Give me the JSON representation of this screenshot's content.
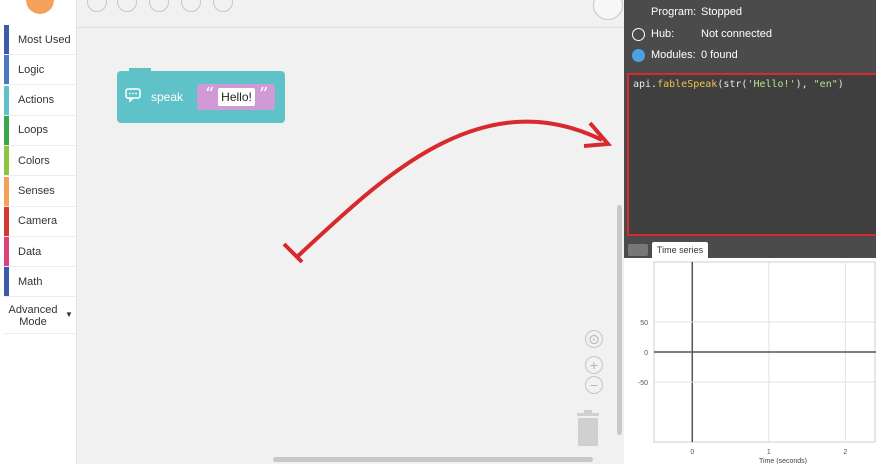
{
  "sidebar": {
    "categories": [
      {
        "label": "Most Used",
        "color": "#3d5aa8"
      },
      {
        "label": "Logic",
        "color": "#4a78c4"
      },
      {
        "label": "Actions",
        "color": "#5fc2c9"
      },
      {
        "label": "Loops",
        "color": "#3aa64a"
      },
      {
        "label": "Colors",
        "color": "#8cc63f"
      },
      {
        "label": "Senses",
        "color": "#f5a15a"
      },
      {
        "label": "Camera",
        "color": "#d23b34"
      },
      {
        "label": "Data",
        "color": "#e0417a"
      },
      {
        "label": "Math",
        "color": "#3d5aa8"
      }
    ],
    "advanced_mode": "Advanced Mode"
  },
  "workspace": {
    "block": {
      "label": "speak",
      "value": "Hello!",
      "color": "#5fc2c9",
      "slot_color": "#cf9ad5"
    },
    "icons": [
      "undo-icon",
      "redo-icon",
      "save-icon",
      "load-icon",
      "settings-icon",
      "search-icon",
      "center-icon",
      "zoom-in-icon",
      "zoom-out-icon",
      "trash-icon"
    ]
  },
  "status": {
    "program_key": "Program:",
    "program_value": "Stopped",
    "hub_key": "Hub:",
    "hub_value": "Not connected",
    "modules_key": "Modules:",
    "modules_value": "0 found"
  },
  "code": {
    "prefix": "api.",
    "fn": "fableSpeak",
    "args_open": "(str(",
    "str": "'Hello!'",
    "args_mid": "), ",
    "lang": "\"en\"",
    "args_close": ")"
  },
  "tabs": {
    "time_series": "Time series"
  },
  "accent": {
    "highlight": "#d8292e",
    "arrow": "#d8292e"
  },
  "chart_data": {
    "type": "line",
    "series": [],
    "xlabel": "Time (seconds)",
    "x_ticks": [
      "0",
      "1",
      "2"
    ],
    "y_ticks": [
      "50",
      "0",
      "-50"
    ],
    "xlim": [
      -0.5,
      2.4
    ],
    "ylim": [
      -150,
      150
    ],
    "grid": true
  }
}
